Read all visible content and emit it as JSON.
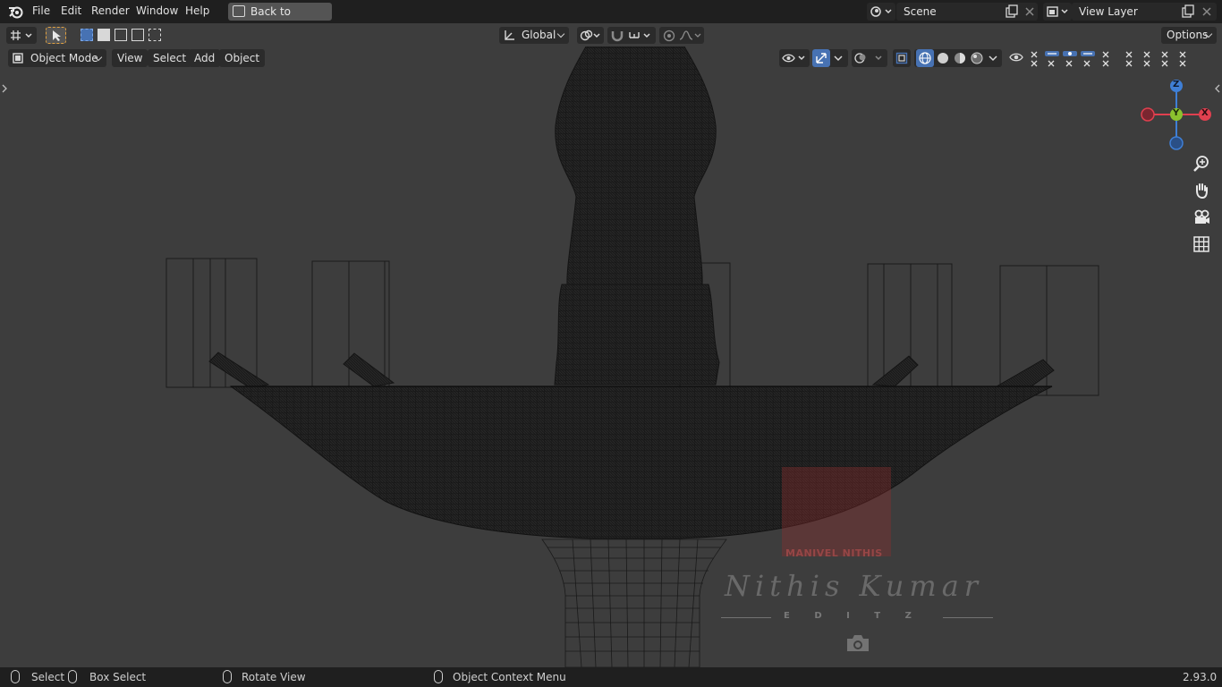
{
  "topbar": {
    "menus": [
      "File",
      "Edit",
      "Render",
      "Window",
      "Help"
    ],
    "back_button": "Back to Previous",
    "scene_name": "Scene",
    "view_layer_name": "View Layer",
    "icons": {
      "app": "blender-logo-icon",
      "back": "fullscreen-back-icon"
    }
  },
  "toolbar": {
    "orientation": "Global",
    "options_label": "Options"
  },
  "viewport_header": {
    "mode": "Object Mode",
    "menus": [
      "View",
      "Select",
      "Add",
      "Object"
    ]
  },
  "gizmo": {
    "z": "Z",
    "y": "Y",
    "x": "X",
    "colors": {
      "x": "#e0404f",
      "y": "#8bc22e",
      "z": "#3f7fd6"
    }
  },
  "watermark": {
    "brand": "MANIVEL NITHIS",
    "signature": "Nithis Kumar",
    "tagline": "E D I T Z"
  },
  "statusbar": {
    "select": "Select",
    "box_select": "Box Select",
    "rotate_view": "Rotate View",
    "context_menu": "Object Context Menu",
    "version": "2.93.0"
  }
}
